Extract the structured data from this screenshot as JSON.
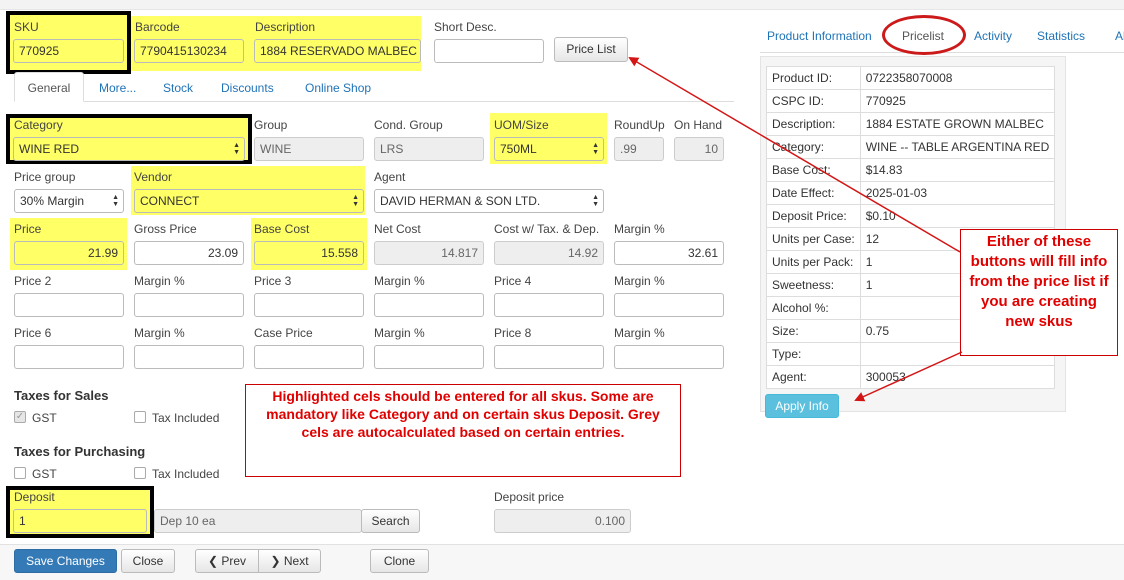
{
  "header": {
    "sku_label": "SKU",
    "sku_value": "770925",
    "barcode_label": "Barcode",
    "barcode_value": "7790415130234",
    "description_label": "Description",
    "description_value": "1884 RESERVADO MALBEC",
    "short_desc_label": "Short Desc.",
    "short_desc_value": "",
    "price_list_button": "Price List"
  },
  "tabs": [
    {
      "label": "General",
      "active": true
    },
    {
      "label": "More..."
    },
    {
      "label": "Stock"
    },
    {
      "label": "Discounts"
    },
    {
      "label": "Online Shop"
    }
  ],
  "form": {
    "category_label": "Category",
    "category_value": "WINE RED",
    "group_label": "Group",
    "group_value": "WINE",
    "cond_group_label": "Cond. Group",
    "cond_group_value": "LRS",
    "uom_label": "UOM/Size",
    "uom_value": "750ML",
    "roundup_label": "RoundUp",
    "roundup_value": ".99",
    "onhand_label": "On Hand",
    "onhand_value": "10",
    "price_group_label": "Price group",
    "price_group_value": "30% Margin",
    "vendor_label": "Vendor",
    "vendor_value": "CONNECT",
    "agent_label": "Agent",
    "agent_value": "DAVID HERMAN & SON LTD.",
    "price_label": "Price",
    "price_value": "21.99",
    "gross_price_label": "Gross Price",
    "gross_price_value": "23.09",
    "base_cost_label": "Base Cost",
    "base_cost_value": "15.558",
    "net_cost_label": "Net Cost",
    "net_cost_value": "14.817",
    "cost_tax_label": "Cost w/ Tax. & Dep.",
    "cost_tax_value": "14.92",
    "margin_label": "Margin %",
    "margin_value": "32.61",
    "price2_label": "Price 2",
    "margin2_label": "Margin %",
    "price3_label": "Price 3",
    "margin3_label": "Margin %",
    "price4_label": "Price 4",
    "margin4_label": "Margin %",
    "price6_label": "Price 6",
    "margin6_label": "Margin %",
    "case_price_label": "Case Price",
    "margin_case_label": "Margin %",
    "price8_label": "Price 8",
    "margin8_label": "Margin %"
  },
  "taxes_sales": {
    "title": "Taxes for Sales",
    "gst_label": "GST",
    "gst_checked": true,
    "tax_included_label": "Tax Included",
    "tax_included_checked": false
  },
  "taxes_purchasing": {
    "title": "Taxes for Purchasing",
    "gst_label": "GST",
    "gst_checked": false,
    "tax_included_label": "Tax Included",
    "tax_included_checked": false
  },
  "deposit": {
    "label": "Deposit",
    "value": "1",
    "description": "Dep 10 ea",
    "search_button": "Search",
    "price_label": "Deposit price",
    "price_value": "0.100"
  },
  "footer": {
    "save_button": "Save Changes",
    "close_button": "Close",
    "prev_button": "Prev",
    "next_button": "Next",
    "clone_button": "Clone"
  },
  "right_tabs": [
    {
      "label": "Product Information"
    },
    {
      "label": "Pricelist",
      "active": true
    },
    {
      "label": "Activity"
    },
    {
      "label": "Statistics"
    },
    {
      "label": "Al"
    }
  ],
  "pricelist": [
    {
      "key": "Product ID:",
      "value": "0722358070008"
    },
    {
      "key": "CSPC ID:",
      "value": "770925"
    },
    {
      "key": "Description:",
      "value": "1884 ESTATE GROWN MALBEC"
    },
    {
      "key": "Category:",
      "value": "WINE -- TABLE ARGENTINA RED"
    },
    {
      "key": "Base Cost:",
      "value": "$14.83"
    },
    {
      "key": "Date Effect:",
      "value": "2025-01-03"
    },
    {
      "key": "Deposit Price:",
      "value": "$0.10"
    },
    {
      "key": "Units per Case:",
      "value": "12"
    },
    {
      "key": "Units per Pack:",
      "value": "1"
    },
    {
      "key": "Sweetness:",
      "value": "1"
    },
    {
      "key": "Alcohol %:",
      "value": ""
    },
    {
      "key": "Size:",
      "value": "0.75"
    },
    {
      "key": "Type:",
      "value": ""
    },
    {
      "key": "Agent:",
      "value": "300053"
    }
  ],
  "apply_info_button": "Apply Info",
  "annotations": {
    "note_buttons": "Either of these buttons will fill info from the price list if you are creating new skus",
    "note_highlight": "Highlighted cels should be entered for all skus. Some are mandatory like Category and on certain skus Deposit. Grey cels are autocalculated based on certain entries.",
    "highlight_color": "#ffff66",
    "annotation_color": "#e00000",
    "link_color": "#1f73b7",
    "primary_color": "#337ab7"
  }
}
